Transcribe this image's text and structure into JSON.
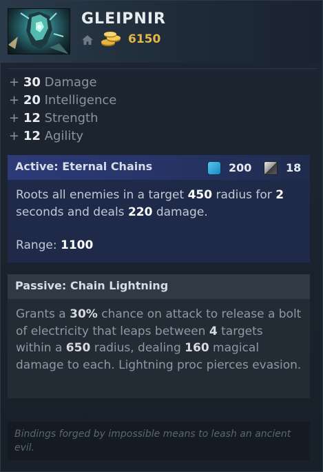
{
  "item": {
    "name": "GLEIPNIR",
    "cost": "6150",
    "icon": "gleipnir-item-icon"
  },
  "icons": {
    "shop": "home-icon",
    "gold": "gold-coins-icon",
    "mana": "mana-icon",
    "cooldown": "cooldown-icon"
  },
  "stats": [
    {
      "plus": "+",
      "value": "30",
      "label": "Damage"
    },
    {
      "plus": "+",
      "value": "20",
      "label": "Intelligence"
    },
    {
      "plus": "+",
      "value": "12",
      "label": "Strength"
    },
    {
      "plus": "+",
      "value": "12",
      "label": "Agility"
    }
  ],
  "active": {
    "title": "Active: Eternal Chains",
    "mana": "200",
    "cooldown": "18",
    "desc": {
      "t1": "Roots all enemies in a target ",
      "v1": "450",
      "t2": " radius for ",
      "v2": "2",
      "t3": " seconds and deals ",
      "v3": "220",
      "t4": " damage."
    },
    "range_label": "Range: ",
    "range_value": "1100"
  },
  "passive": {
    "title": "Passive: Chain Lightning",
    "desc": {
      "t1": "Grants a ",
      "v1": "30%",
      "t2": " chance on attack to release a bolt of electricity that leaps between ",
      "v2": "4",
      "t3": " targets within a ",
      "v3": "650",
      "t4": " radius, dealing ",
      "v4": "160",
      "t5": " magical damage to each. Lightning proc pierces evasion."
    }
  },
  "lore": "Bindings forged by impossible means to leash an ancient evil.",
  "colors": {
    "gold": "#e6b84a",
    "active_header": "#2c3a78",
    "mana": "#2aa0dc"
  }
}
